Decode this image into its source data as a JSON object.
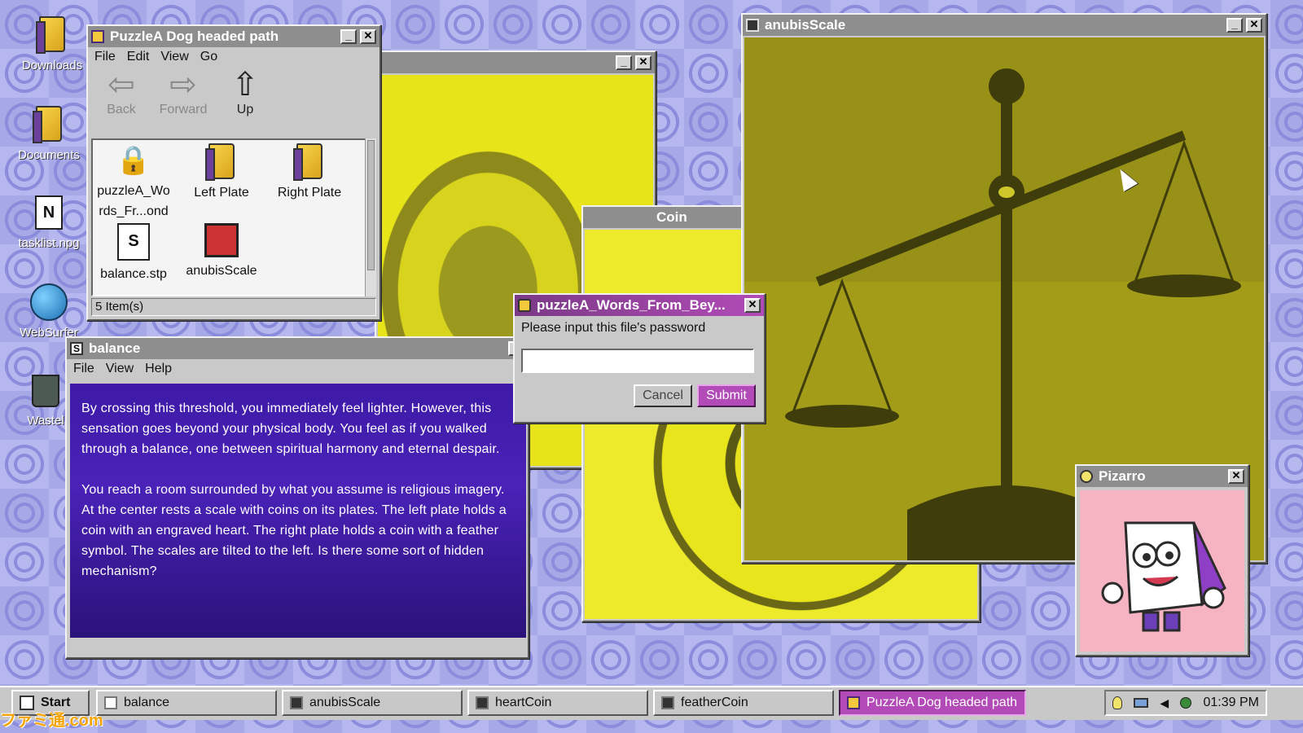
{
  "desktop": {
    "icons": [
      {
        "label": "Downloads"
      },
      {
        "label": "Documents"
      },
      {
        "label": "tasklist.npg"
      },
      {
        "label": "WebSurfer"
      },
      {
        "label": "Wastel"
      }
    ]
  },
  "explorer": {
    "title": "PuzzleA Dog headed path",
    "menu": [
      "File",
      "Edit",
      "View",
      "Go"
    ],
    "nav": {
      "back": "Back",
      "forward": "Forward",
      "up": "Up"
    },
    "files": [
      {
        "label": "puzzleA_Words_Fr...ond"
      },
      {
        "label": "Left Plate"
      },
      {
        "label": "Right Plate"
      },
      {
        "label": "balance.stp"
      },
      {
        "label": "anubisScale"
      }
    ],
    "status": "5 Item(s)"
  },
  "coin_window": {
    "title": "Coin"
  },
  "anubis": {
    "title": "anubisScale"
  },
  "balance": {
    "title": "balance",
    "menu": [
      "File",
      "View",
      "Help"
    ],
    "paragraph1": "By crossing this threshold, you immediately feel lighter. However, this sensation goes beyond your physical body. You feel as if you walked through a balance, one between spiritual harmony and eternal despair.",
    "paragraph2": "You reach a room surrounded by what you assume is religious imagery. At the center rests a scale with coins on its plates. The left plate holds a coin with an engraved heart. The right plate holds a coin with a feather symbol. The scales are tilted to the left. Is there some sort of hidden mechanism?"
  },
  "password_dialog": {
    "title": "puzzleA_Words_From_Bey...",
    "prompt": "Please input this file's password",
    "input_value": "",
    "cancel": "Cancel",
    "submit": "Submit"
  },
  "pizarro": {
    "title": "Pizarro"
  },
  "taskbar": {
    "start": "Start",
    "tasks": [
      {
        "label": "balance"
      },
      {
        "label": "anubisScale"
      },
      {
        "label": "heartCoin"
      },
      {
        "label": "featherCoin"
      },
      {
        "label": "PuzzleA Dog headed path"
      }
    ],
    "clock": "01:39 PM"
  },
  "watermark": "ファミ通.com",
  "colors": {
    "accent": "#b24bb7",
    "desktop": "#a7a8e6",
    "image_tint": "#b3ac16",
    "text_panel": "#4a1fa8"
  }
}
